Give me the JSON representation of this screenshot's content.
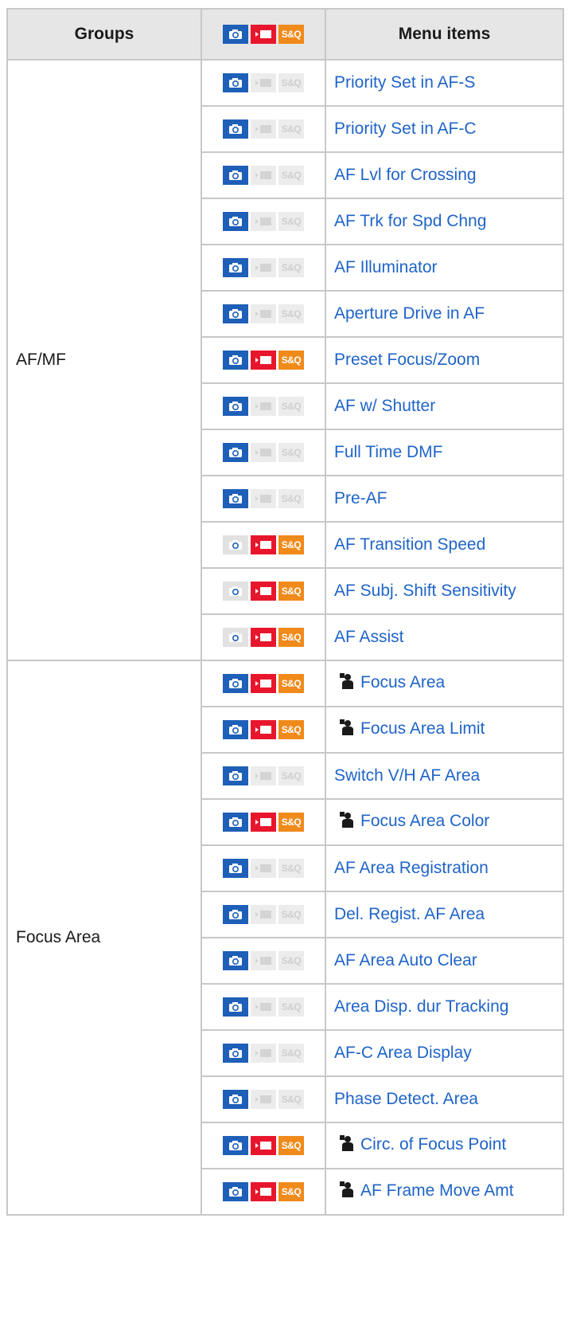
{
  "header": {
    "groups": "Groups",
    "mode_icons": [
      "photo-icon",
      "movie-icon",
      "s-and-q-icon"
    ],
    "sq_label": "S&Q",
    "menu_items": "Menu items"
  },
  "colors": {
    "photo": "#1e5fb8",
    "movie": "#e8162d",
    "sq": "#f08a1a",
    "link": "#1f64c8",
    "disabled": "#e2e2e2"
  },
  "groups": [
    {
      "label": "AF/MF",
      "items": [
        {
          "label": "Priority Set in AF-S",
          "photo": true,
          "movie": false,
          "sq": false,
          "prefix_icon": false
        },
        {
          "label": "Priority Set in AF-C",
          "photo": true,
          "movie": false,
          "sq": false,
          "prefix_icon": false
        },
        {
          "label": "AF Lvl for Crossing",
          "photo": true,
          "movie": false,
          "sq": false,
          "prefix_icon": false
        },
        {
          "label": "AF Trk for Spd Chng",
          "photo": true,
          "movie": false,
          "sq": false,
          "prefix_icon": false
        },
        {
          "label": "AF Illuminator",
          "photo": true,
          "movie": false,
          "sq": false,
          "prefix_icon": false
        },
        {
          "label": "Aperture Drive in AF",
          "photo": true,
          "movie": false,
          "sq": false,
          "prefix_icon": false
        },
        {
          "label": "Preset Focus/Zoom",
          "photo": true,
          "movie": true,
          "sq": true,
          "prefix_icon": false
        },
        {
          "label": "AF w/ Shutter",
          "photo": true,
          "movie": false,
          "sq": false,
          "prefix_icon": false
        },
        {
          "label": "Full Time DMF",
          "photo": true,
          "movie": false,
          "sq": false,
          "prefix_icon": false
        },
        {
          "label": "Pre-AF",
          "photo": true,
          "movie": false,
          "sq": false,
          "prefix_icon": false
        },
        {
          "label": "AF Transition Speed",
          "photo": false,
          "movie": true,
          "sq": true,
          "prefix_icon": false
        },
        {
          "label": "AF Subj. Shift Sensitivity",
          "photo": false,
          "movie": true,
          "sq": true,
          "prefix_icon": false
        },
        {
          "label": "AF Assist",
          "photo": false,
          "movie": true,
          "sq": true,
          "prefix_icon": false
        }
      ]
    },
    {
      "label": "Focus Area",
      "items": [
        {
          "label": "Focus Area",
          "photo": true,
          "movie": true,
          "sq": true,
          "prefix_icon": true
        },
        {
          "label": "Focus Area Limit",
          "photo": true,
          "movie": true,
          "sq": true,
          "prefix_icon": true
        },
        {
          "label": "Switch V/H AF Area",
          "photo": true,
          "movie": false,
          "sq": false,
          "prefix_icon": false
        },
        {
          "label": "Focus Area Color",
          "photo": true,
          "movie": true,
          "sq": true,
          "prefix_icon": true
        },
        {
          "label": "AF Area Registration",
          "photo": true,
          "movie": false,
          "sq": false,
          "prefix_icon": false
        },
        {
          "label": "Del. Regist. AF Area",
          "photo": true,
          "movie": false,
          "sq": false,
          "prefix_icon": false
        },
        {
          "label": "AF Area Auto Clear",
          "photo": true,
          "movie": false,
          "sq": false,
          "prefix_icon": false
        },
        {
          "label": "Area Disp. dur Tracking",
          "photo": true,
          "movie": false,
          "sq": false,
          "prefix_icon": false
        },
        {
          "label": "AF-C Area Display",
          "photo": true,
          "movie": false,
          "sq": false,
          "prefix_icon": false
        },
        {
          "label": "Phase Detect. Area",
          "photo": true,
          "movie": false,
          "sq": false,
          "prefix_icon": false
        },
        {
          "label": "Circ. of Focus Point",
          "photo": true,
          "movie": true,
          "sq": true,
          "prefix_icon": true
        },
        {
          "label": "AF Frame Move Amt",
          "photo": true,
          "movie": true,
          "sq": true,
          "prefix_icon": true
        }
      ]
    }
  ]
}
